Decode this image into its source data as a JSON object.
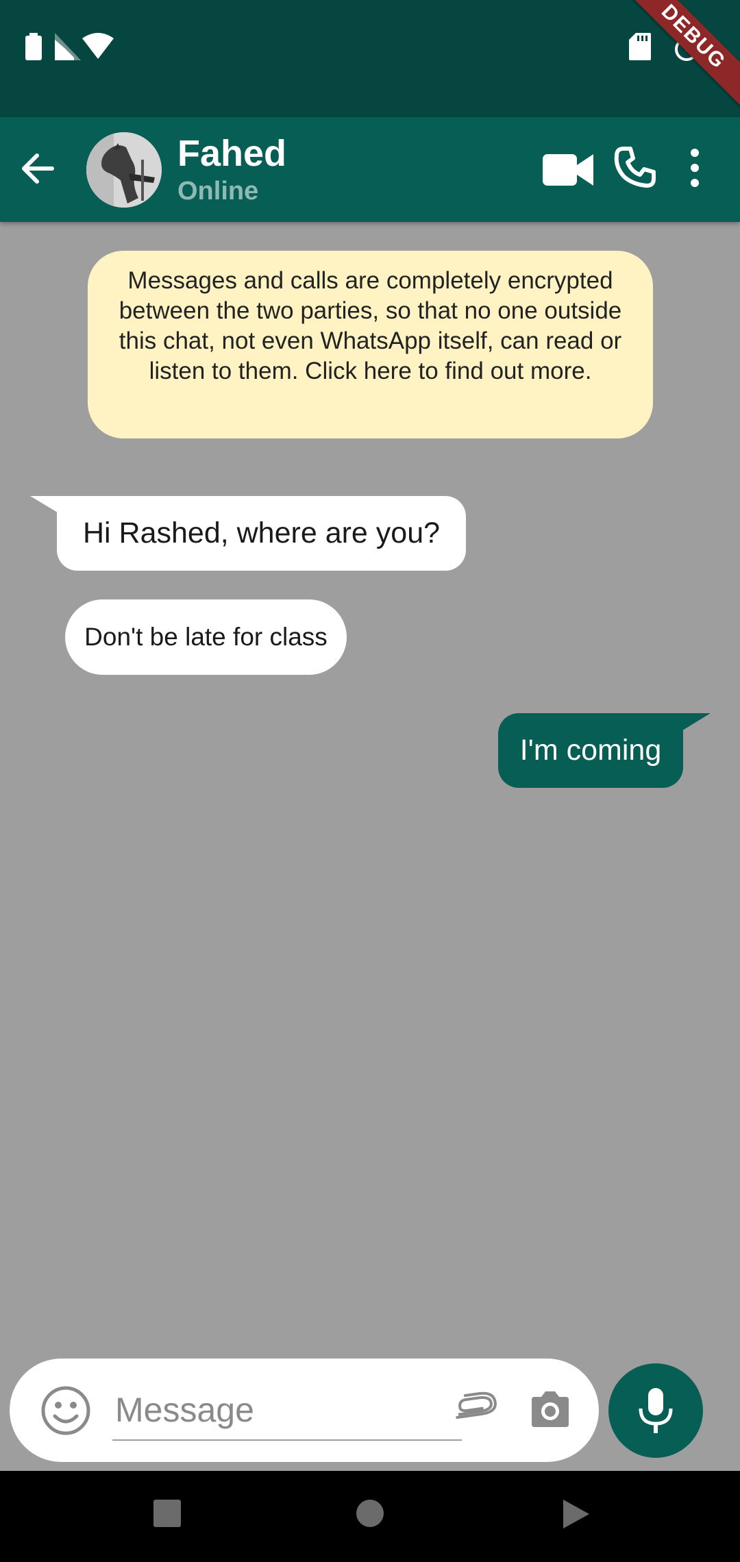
{
  "colors": {
    "status_bar": "#064640",
    "app_bar": "#075e54",
    "chat_background": "#9e9e9e",
    "notice_background": "#fff3c4",
    "outgoing_bubble": "#075e54",
    "incoming_bubble": "#ffffff",
    "debug_ribbon": "#8e2727"
  },
  "status_bar": {
    "left_icons": [
      "battery-icon",
      "cell-signal-icon",
      "wifi-icon"
    ],
    "right_icons": [
      "sd-card-icon",
      "alarm-icon"
    ],
    "debug_label": "DEBUG"
  },
  "header": {
    "back_icon": "arrow-left-icon",
    "contact_name": "Fahed",
    "contact_status": "Online",
    "actions": [
      "video-camera-icon",
      "phone-icon",
      "more-vertical-icon"
    ]
  },
  "chat": {
    "encryption_notice": "Messages and calls are completely encrypted between the two parties, so that no one outside this chat, not even WhatsApp itself, can read or listen to them. Click here to find out more.",
    "messages": [
      {
        "direction": "incoming",
        "text": "Hi Rashed, where are you?"
      },
      {
        "direction": "incoming",
        "text": "Don't be late for class"
      },
      {
        "direction": "outgoing",
        "text": "I'm coming"
      }
    ]
  },
  "composer": {
    "placeholder": "Message",
    "value": "",
    "icons": [
      "emoji-icon",
      "paperclip-icon",
      "camera-icon",
      "microphone-icon"
    ]
  },
  "nav_bar": {
    "buttons": [
      "recents-square-icon",
      "home-circle-icon",
      "back-triangle-icon"
    ]
  }
}
